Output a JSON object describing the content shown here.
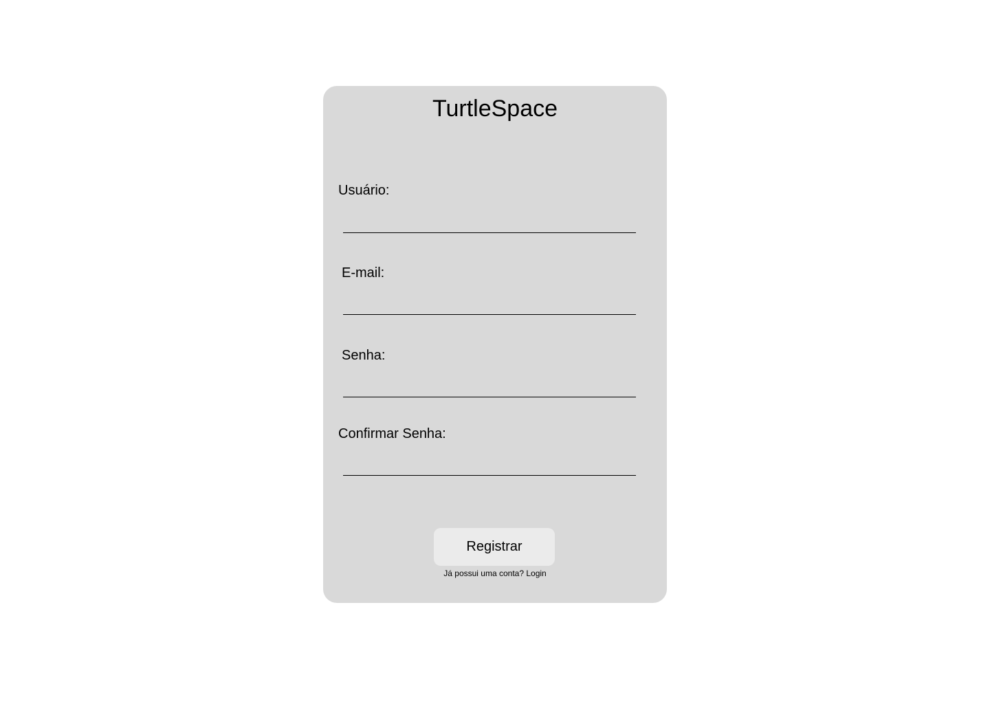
{
  "app": {
    "title": "TurtleSpace"
  },
  "form": {
    "username_label": "Usuário:",
    "email_label": "E-mail:",
    "password_label": "Senha:",
    "confirm_password_label": "Confirmar Senha:",
    "username_value": "",
    "email_value": "",
    "password_value": "",
    "confirm_password_value": ""
  },
  "actions": {
    "register_label": "Registrar",
    "have_account_text": "Já possui uma conta?",
    "login_link": "Login"
  },
  "colors": {
    "card_background": "#d9d9d9",
    "button_background": "#ebebeb",
    "page_background": "#ffffff"
  }
}
